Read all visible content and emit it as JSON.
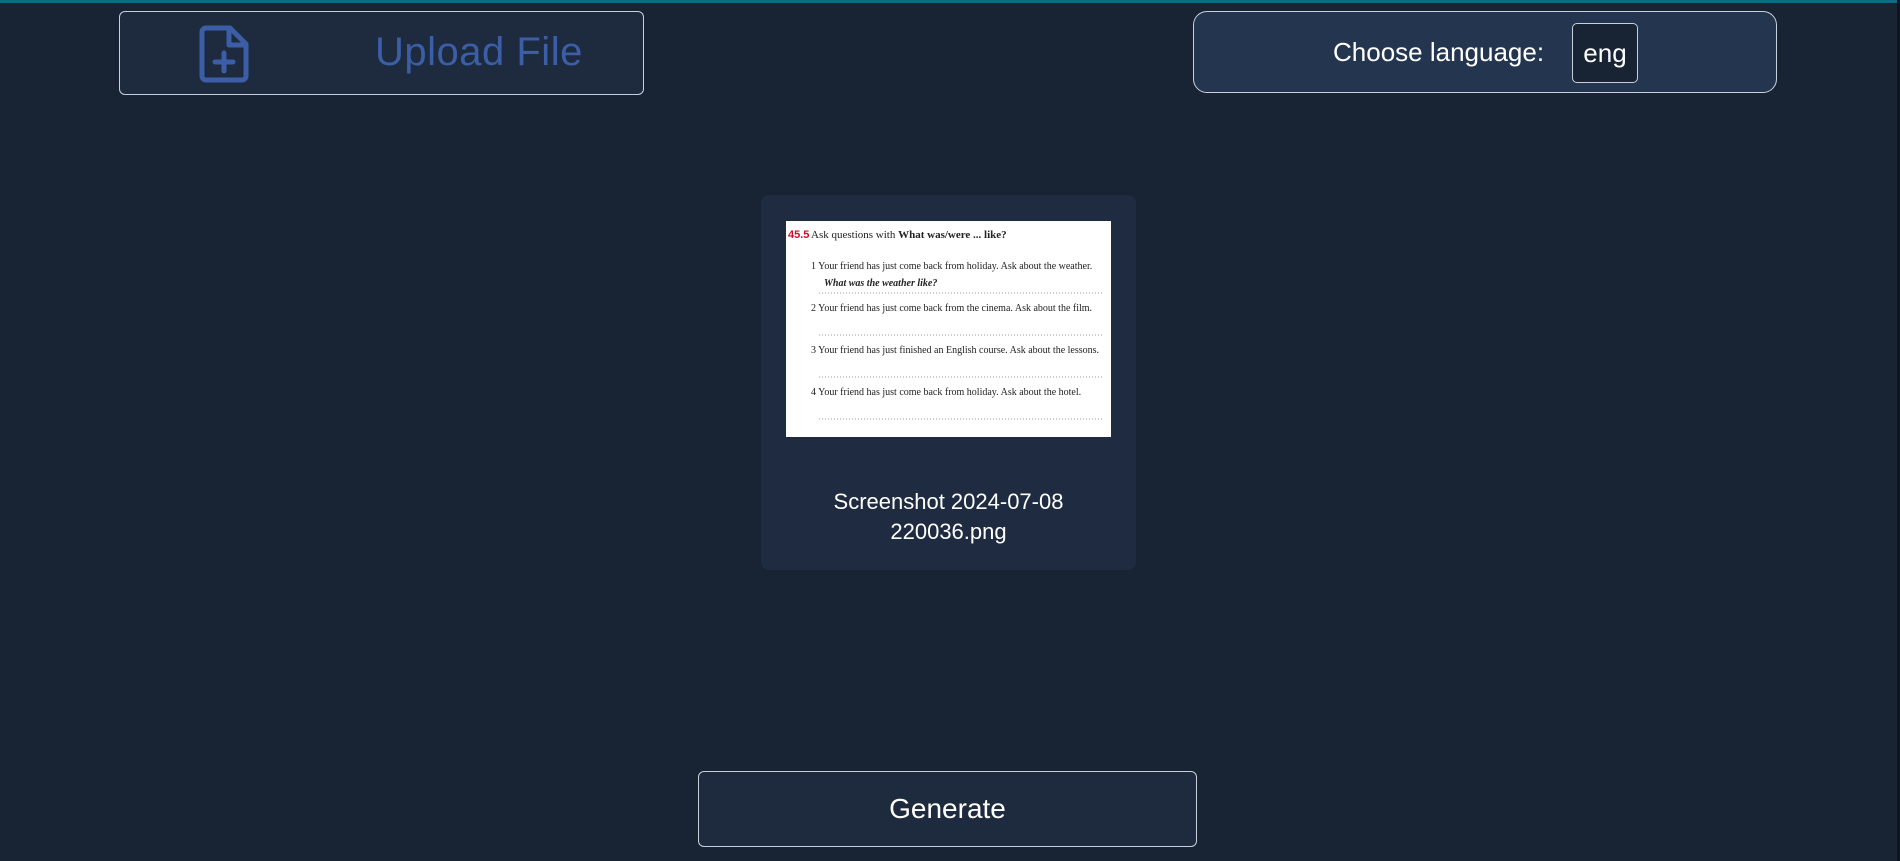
{
  "upload": {
    "label": "Upload File",
    "icon": "file-plus-icon",
    "color": "#3b5ea6"
  },
  "language": {
    "label": "Choose language:",
    "selected": "eng"
  },
  "file": {
    "name": "Screenshot 2024-07-08 220036.png",
    "thumbnail": {
      "section_number": "45.5",
      "heading_prefix": "Ask questions with ",
      "heading_bold": "What was/were ... like?",
      "items": [
        {
          "num": "1",
          "text": "Your friend has just come back from holiday. Ask about the weather.",
          "answer": "What was the weather like?"
        },
        {
          "num": "2",
          "text": "Your friend has just come back from the cinema. Ask about the film.",
          "answer": ""
        },
        {
          "num": "3",
          "text": "Your friend has just finished an English course. Ask about the lessons.",
          "answer": ""
        },
        {
          "num": "4",
          "text": "Your friend has just come back from holiday. Ask about the hotel.",
          "answer": ""
        }
      ]
    }
  },
  "actions": {
    "generate_label": "Generate"
  },
  "colors": {
    "background": "#182334",
    "panel": "#243550",
    "card": "#1e2b40",
    "accent_line": "#0e6a86",
    "section_number_red": "#c8102e"
  }
}
